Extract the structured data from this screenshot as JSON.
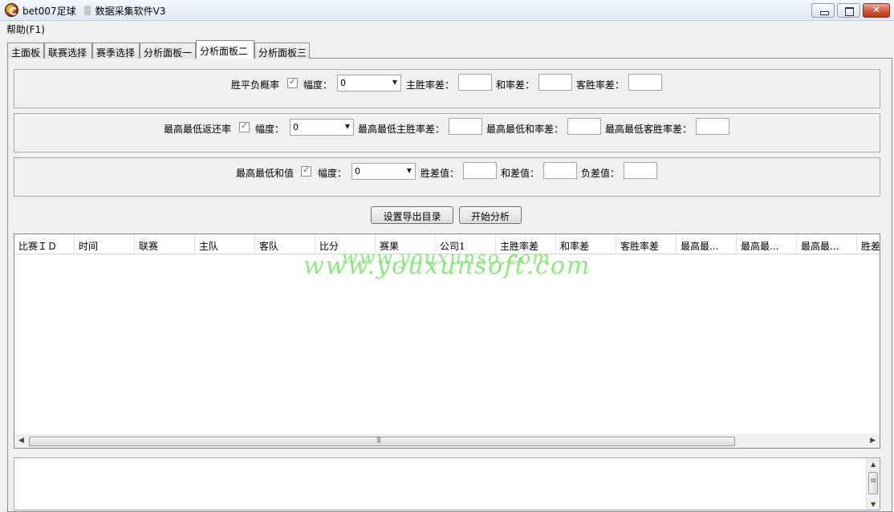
{
  "window": {
    "title": "bet007足球",
    "subtitle": "数据采集软件V3"
  },
  "menu": {
    "help": "帮助(F1)"
  },
  "tabs": [
    {
      "label": "主面板"
    },
    {
      "label": "联赛选择"
    },
    {
      "label": "赛季选择"
    },
    {
      "label": "分析面板一"
    },
    {
      "label": "分析面板二"
    },
    {
      "label": "分析面板三"
    }
  ],
  "active_tab": "分析面板二",
  "group1": {
    "check_label": "胜平负概率",
    "checked": true,
    "range_label": "幅度：",
    "range_value": "0",
    "f1_label": "主胜率差：",
    "f1_value": "",
    "f2_label": "和率差：",
    "f2_value": "",
    "f3_label": "客胜率差：",
    "f3_value": ""
  },
  "group2": {
    "check_label": "最高最低返还率",
    "checked": true,
    "range_label": "幅度：",
    "range_value": "0",
    "f1_label": "最高最低主胜率差：",
    "f1_value": "",
    "f2_label": "最高最低和率差：",
    "f2_value": "",
    "f3_label": "最高最低客胜率差：",
    "f3_value": ""
  },
  "group3": {
    "check_label": "最高最低和值",
    "checked": true,
    "range_label": "幅度：",
    "range_value": "0",
    "f1_label": "胜差值：",
    "f1_value": "",
    "f2_label": "和差值：",
    "f2_value": "",
    "f3_label": "负差值：",
    "f3_value": ""
  },
  "buttons": {
    "export_dir": "设置导出目录",
    "start": "开始分析"
  },
  "grid": {
    "columns": [
      "比赛ＩＤ",
      "时间",
      "联赛",
      "主队",
      "客队",
      "比分",
      "赛果",
      "公司1",
      "主胜率差",
      "和率差",
      "客胜率差",
      "最高最...",
      "最高最...",
      "最高最...",
      "胜差"
    ],
    "rows": []
  },
  "watermark": {
    "line1": "www.youxunso.com",
    "line2": "www.youxunsoft.com",
    "color": "#7ce36c"
  },
  "log": {
    "text": ""
  }
}
